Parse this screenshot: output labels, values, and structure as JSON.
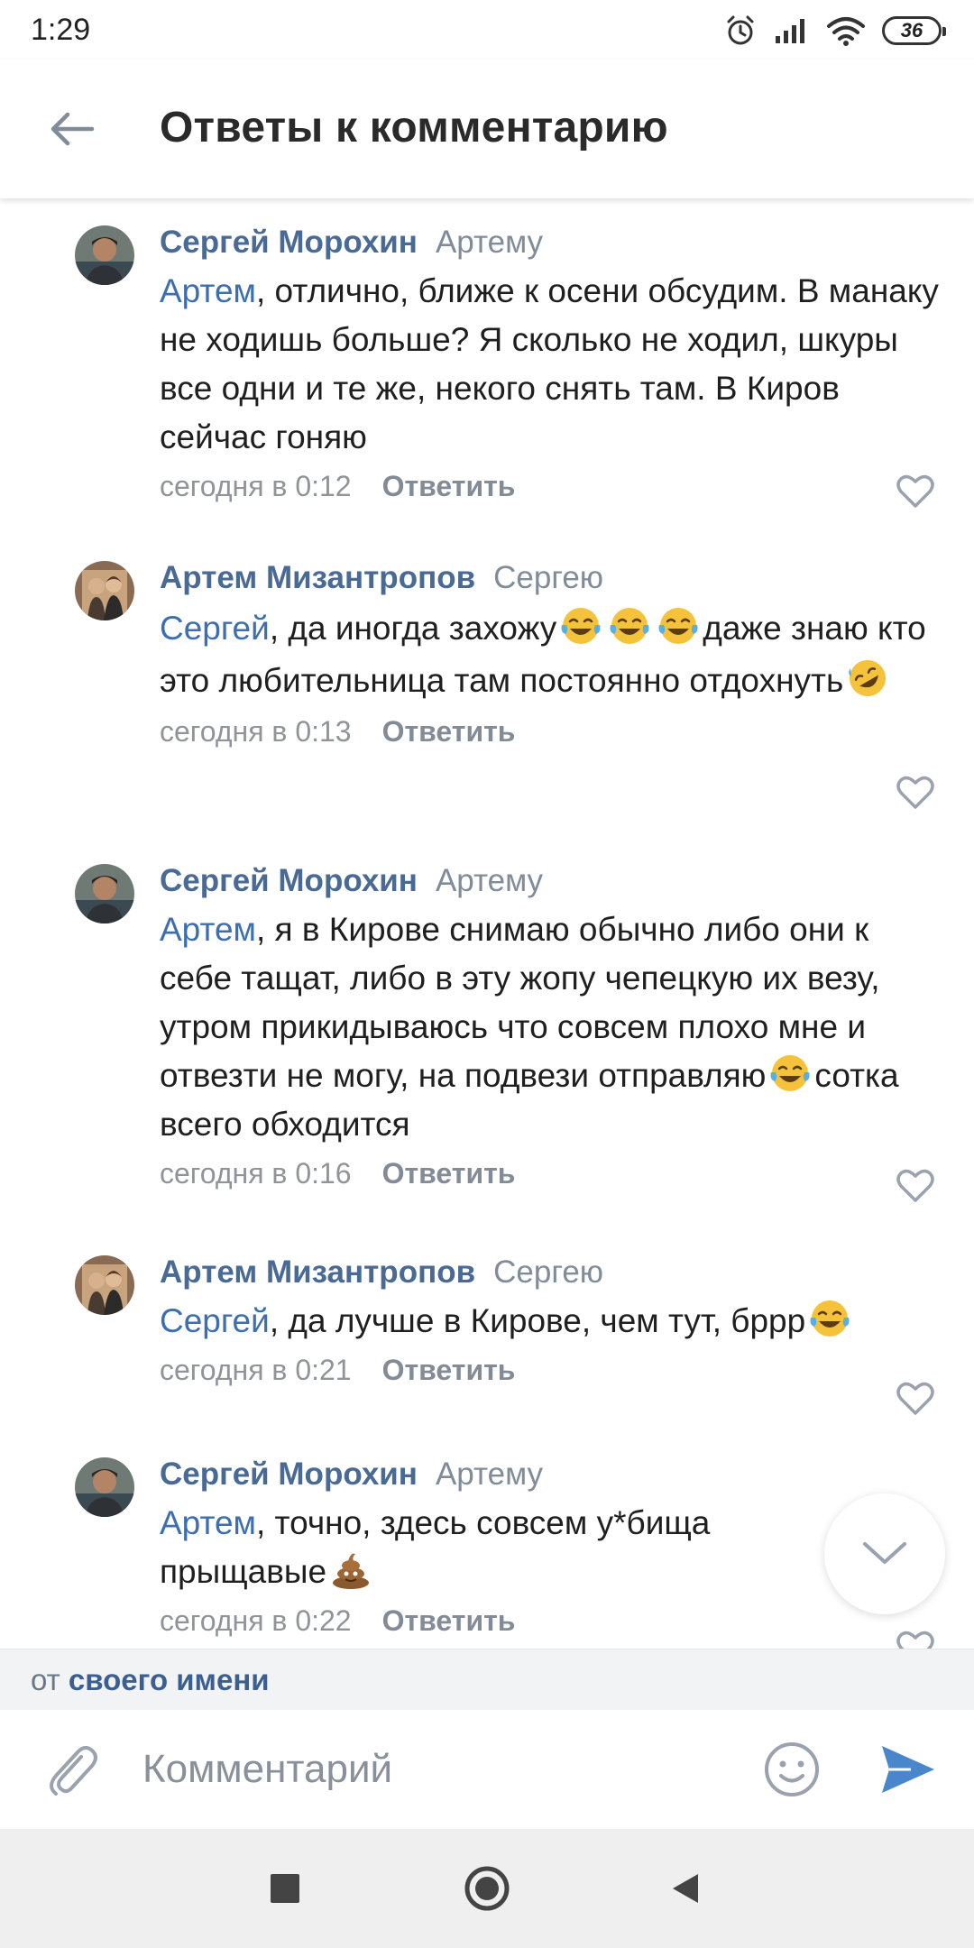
{
  "status_bar": {
    "time": "1:29",
    "battery": "36"
  },
  "header": {
    "title": "Ответы к комментарию"
  },
  "comments": [
    {
      "author": "Сергей Морохин",
      "reply_to": "Артему",
      "mention": "Артем",
      "text_before": ", отлично, ближе к осени обсудим. В манаку не ходишь больше? Я сколько не ходил, шкуры все одни и те же, некого снять там. В Киров сейчас гоняю",
      "text_after": "",
      "text_end": "",
      "time": "сегодня в 0:12",
      "reply_label": "Ответить",
      "avatar": "sergey"
    },
    {
      "author": "Артем Мизантропов",
      "reply_to": "Сергею",
      "mention": "Сергей",
      "text_before": ", да иногда захожу",
      "text_after": "даже знаю кто это любительница там постоянно отдохнуть",
      "text_end": "",
      "time": "сегодня в 0:13",
      "reply_label": "Ответить",
      "avatar": "artem"
    },
    {
      "author": "Сергей Морохин",
      "reply_to": "Артему",
      "mention": "Артем",
      "text_before": ", я в Кирове снимаю обычно либо они к себе тащат, либо в эту жопу чепецкую их везу, утром прикидываюсь что совсем плохо мне и отвезти не могу, на подвези отправляю",
      "text_after": "сотка всего обходится",
      "text_end": "",
      "time": "сегодня в 0:16",
      "reply_label": "Ответить",
      "avatar": "sergey"
    },
    {
      "author": "Артем Мизантропов",
      "reply_to": "Сергею",
      "mention": "Сергей",
      "text_before": ", да лучше в Кирове, чем тут, бррр",
      "text_after": "",
      "text_end": "",
      "time": "сегодня в 0:21",
      "reply_label": "Ответить",
      "avatar": "artem"
    },
    {
      "author": "Сергей Морохин",
      "reply_to": "Артему",
      "mention": "Артем",
      "text_before": ", точно, здесь совсем у*бища прыщавые",
      "text_after": "",
      "text_end": "",
      "time": "сегодня в 0:22",
      "reply_label": "Ответить",
      "avatar": "sergey"
    }
  ],
  "author_strip": {
    "prefix": "от",
    "link": "своего имени"
  },
  "composer": {
    "placeholder": "Комментарий"
  },
  "colors": {
    "link": "#3d6fb0",
    "author": "#4a6a96",
    "meta": "#909499",
    "send": "#4986cc"
  }
}
